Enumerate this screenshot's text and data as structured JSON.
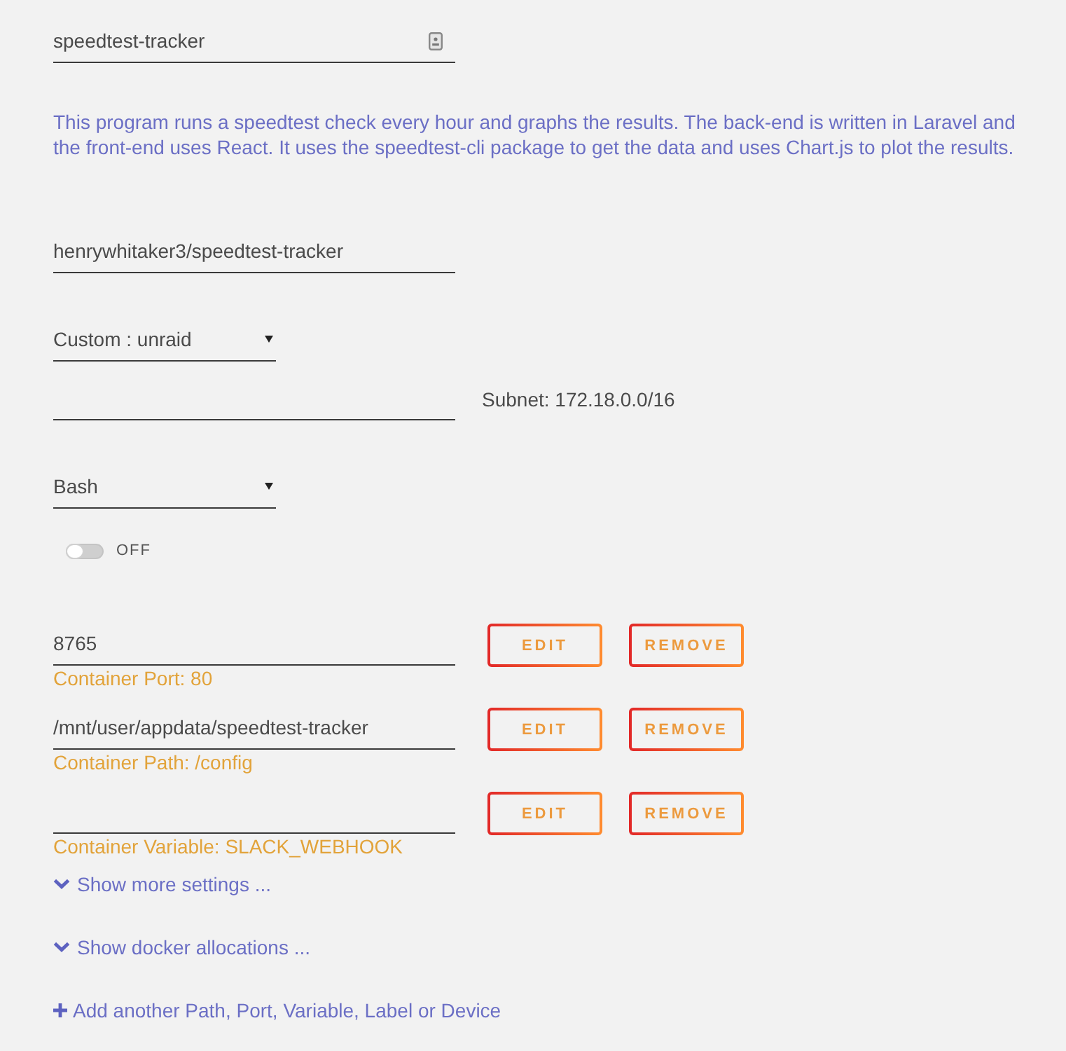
{
  "name_field": {
    "value": "speedtest-tracker"
  },
  "description": "This program runs a speedtest check every hour and graphs the results. The back-end is written in Laravel and the front-end uses React. It uses the speedtest-cli package to get the data and uses Chart.js to plot the results.",
  "repository_field": {
    "value": "henrywhitaker3/speedtest-tracker"
  },
  "network_select": {
    "value": "Custom : unraid"
  },
  "ip_field": {
    "note": "Subnet: 172.18.0.0/16"
  },
  "console_select": {
    "value": "Bash"
  },
  "privileged_toggle": {
    "on": false,
    "label": "OFF"
  },
  "config_items": [
    {
      "value": "8765",
      "description": "Container Port: 80",
      "buttons": [
        "EDIT",
        "REMOVE"
      ]
    },
    {
      "value": "/mnt/user/appdata/speedtest-tracker",
      "description": "Container Path: /config",
      "buttons": [
        "EDIT",
        "REMOVE"
      ]
    },
    {
      "description": "Container Variable: SLACK_WEBHOOK",
      "buttons": [
        "EDIT",
        "REMOVE"
      ]
    }
  ],
  "links": [
    {
      "kind": "expand",
      "label": "Show more settings ..."
    },
    {
      "kind": "expand",
      "label": "Show docker allocations ..."
    },
    {
      "kind": "add",
      "label": "Add another Path, Port, Variable, Label or Device"
    }
  ]
}
